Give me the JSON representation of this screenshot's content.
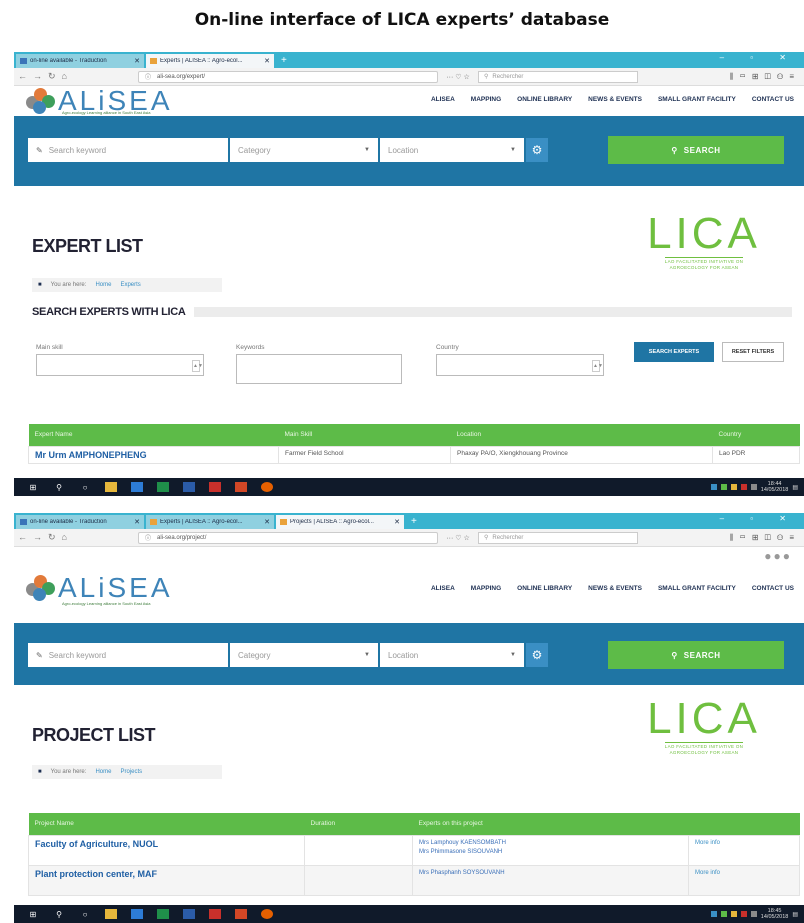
{
  "caption": "On-line interface of LICA experts’ database",
  "shot1": {
    "tabs": [
      {
        "label": "on-line available - Traduction",
        "active": false
      },
      {
        "label": "Experts | ALISEA :: Agro-ecol...",
        "active": true
      }
    ],
    "url": "ali-sea.org/expert/",
    "search_placeholder": "Rechercher",
    "page_title": "EXPERT LIST",
    "breadcrumb": {
      "you_are_here": "You are here:",
      "home": "Home",
      "current": "Experts"
    },
    "section_title": "SEARCH EXPERTS WITH LICA",
    "filters": {
      "main_skill": "Main skill",
      "keywords": "Keywords",
      "country": "Country"
    },
    "buttons": {
      "search_experts": "SEARCH EXPERTS",
      "reset_filters": "RESET FILTERS"
    },
    "table": {
      "headers": [
        "Expert Name",
        "Main Skill",
        "Location",
        "Country"
      ],
      "rows": [
        {
          "name": "Mr Urm AMPHONEPHENG",
          "skill": "Farmer Field School",
          "location": "Phaxay PA/O, Xiengkhouang Province",
          "country": "Lao PDR"
        }
      ]
    },
    "clock": {
      "time": "18:44",
      "date": "14/05/2018"
    }
  },
  "shot2": {
    "tabs": [
      {
        "label": "on-line available - Traduction",
        "active": false
      },
      {
        "label": "Experts | ALISEA :: Agro-ecol...",
        "active": false
      },
      {
        "label": "Projects | ALISEA :: Agro-ecol...",
        "active": true
      }
    ],
    "url": "ali-sea.org/project/",
    "search_placeholder": "Rechercher",
    "page_title": "PROJECT LIST",
    "breadcrumb": {
      "you_are_here": "You are here:",
      "home": "Home",
      "current": "Projects"
    },
    "table": {
      "headers": [
        "Project Name",
        "Duration",
        "Experts on this project",
        ""
      ],
      "rows": [
        {
          "name": "Faculty of Agriculture, NUOL",
          "duration": "",
          "experts": [
            "Mrs Lamphouy KAENSOMBATH",
            "Mrs Phimmasone SISOUVANH"
          ],
          "more": "More info"
        },
        {
          "name": "Plant protection center, MAF",
          "duration": "",
          "experts": [
            "Mrs Phasphanh SOYSOUVANH"
          ],
          "more": "More info"
        }
      ]
    },
    "clock": {
      "time": "18:45",
      "date": "14/05/2018"
    }
  },
  "site": {
    "brand": "ALiSEA",
    "tagline": "Agro-ecology Learning alliance in South East Asia",
    "nav": [
      "ALISEA",
      "MAPPING",
      "ONLINE LIBRARY",
      "NEWS & EVENTS",
      "SMALL GRANT FACILITY",
      "CONTACT US"
    ],
    "search": {
      "keyword": "Search keyword",
      "category": "Category",
      "location": "Location",
      "button": "SEARCH"
    }
  },
  "lica": {
    "logo": "LICA",
    "subtitle1": "LAO FACILITATED INITIATIVE ON",
    "subtitle2": "AGROECOLOGY FOR ASEAN"
  },
  "colors": {
    "site_blue": "#1f75a4",
    "green": "#5dbb48",
    "lica_green": "#6fbf3f",
    "tab_cyan": "#39b3cf",
    "taskbar": "#101a2a"
  },
  "icons": {
    "search": "magnifier-icon",
    "settings": "gear-icon",
    "edit": "pencil-icon",
    "home": "home-icon",
    "windows": "windows-icon",
    "firefox": "firefox-icon"
  }
}
